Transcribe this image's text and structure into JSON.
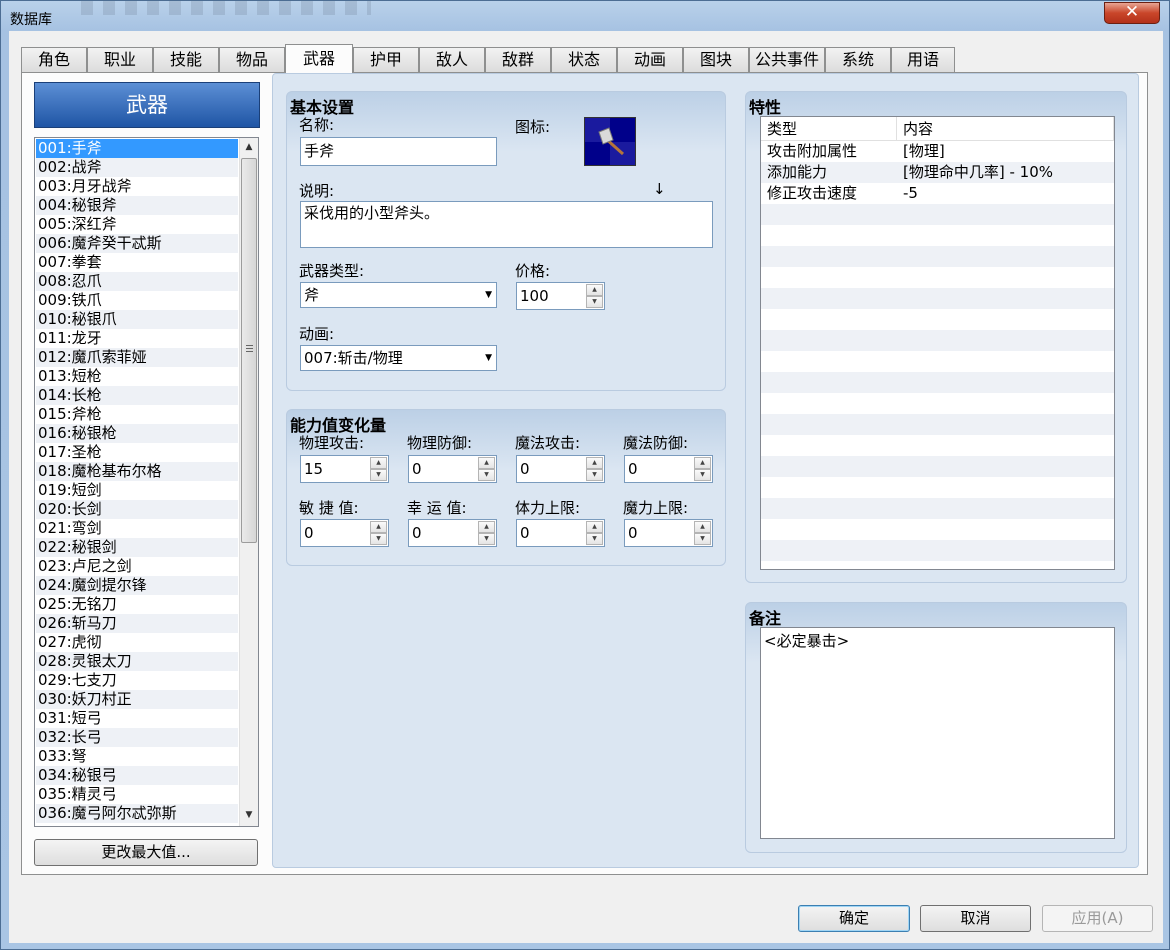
{
  "window": {
    "title": "数据库",
    "close_label": "✕"
  },
  "tabs": [
    {
      "label": "角色"
    },
    {
      "label": "职业"
    },
    {
      "label": "技能"
    },
    {
      "label": "物品"
    },
    {
      "label": "武器"
    },
    {
      "label": "护甲"
    },
    {
      "label": "敌人"
    },
    {
      "label": "敌群"
    },
    {
      "label": "状态"
    },
    {
      "label": "动画"
    },
    {
      "label": "图块"
    },
    {
      "label": "公共事件"
    },
    {
      "label": "系统"
    },
    {
      "label": "用语"
    }
  ],
  "active_tab": "武器",
  "list": {
    "header": "武器",
    "items": [
      "001:手斧",
      "002:战斧",
      "003:月牙战斧",
      "004:秘银斧",
      "005:深红斧",
      "006:魔斧癸干忒斯",
      "007:拳套",
      "008:忍爪",
      "009:铁爪",
      "010:秘银爪",
      "011:龙牙",
      "012:魔爪索菲娅",
      "013:短枪",
      "014:长枪",
      "015:斧枪",
      "016:秘银枪",
      "017:圣枪",
      "018:魔枪基布尔格",
      "019:短剑",
      "020:长剑",
      "021:弯剑",
      "022:秘银剑",
      "023:卢尼之剑",
      "024:魔剑提尔锋",
      "025:无铭刀",
      "026:斩马刀",
      "027:虎彻",
      "028:灵银太刀",
      "029:七支刀",
      "030:妖刀村正",
      "031:短弓",
      "032:长弓",
      "033:弩",
      "034:秘银弓",
      "035:精灵弓",
      "036:魔弓阿尔忒弥斯"
    ],
    "selected_index": 0,
    "change_max_label": "更改最大值..."
  },
  "basic": {
    "title": "基本设置",
    "name_label": "名称:",
    "name_value": "手斧",
    "icon_label": "图标:",
    "desc_label": "说明:",
    "desc_arrow": "↓",
    "desc_value": "采伐用的小型斧头。",
    "type_label": "武器类型:",
    "type_value": "斧",
    "price_label": "价格:",
    "price_value": "100",
    "anim_label": "动画:",
    "anim_value": "007:斩击/物理"
  },
  "params": {
    "title": "能力值变化量",
    "fields": [
      {
        "label": "物理攻击:",
        "value": "15"
      },
      {
        "label": "物理防御:",
        "value": "0"
      },
      {
        "label": "魔法攻击:",
        "value": "0"
      },
      {
        "label": "魔法防御:",
        "value": "0"
      },
      {
        "label": "敏 捷 值:",
        "value": "0"
      },
      {
        "label": "幸 运 值:",
        "value": "0"
      },
      {
        "label": "体力上限:",
        "value": "0"
      },
      {
        "label": "魔力上限:",
        "value": "0"
      }
    ]
  },
  "traits": {
    "title": "特性",
    "col_type": "类型",
    "col_content": "内容",
    "rows": [
      {
        "type": "攻击附加属性",
        "content": "[物理]"
      },
      {
        "type": "添加能力",
        "content": "[物理命中几率] - 10%"
      },
      {
        "type": "修正攻击速度",
        "content": "-5"
      }
    ]
  },
  "notes": {
    "title": "备注",
    "value": "<必定暴击>"
  },
  "footer": {
    "ok": "确定",
    "cancel": "取消",
    "apply": "应用(A)"
  }
}
